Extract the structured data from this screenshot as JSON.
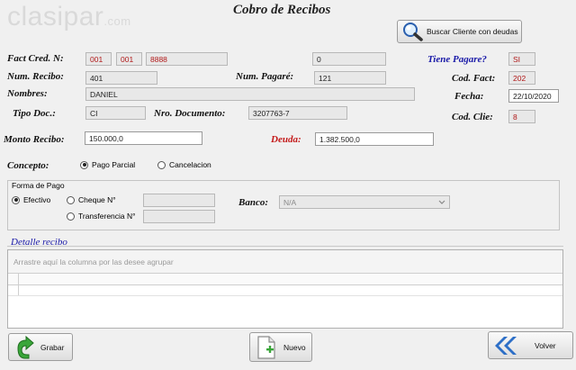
{
  "logo": {
    "text": "clasipar",
    "suffix": ".com"
  },
  "window": {
    "title": "Cobro de Recibos"
  },
  "buttons": {
    "buscar": "Buscar Cliente con deudas",
    "grabar": "Grabar",
    "nuevo": "Nuevo",
    "volver": "Volver"
  },
  "labels": {
    "fact_cred": "Fact Cred. N:",
    "num_recibo": "Num. Recibo:",
    "num_pagare": "Num. Pagaré:",
    "nombres": "Nombres:",
    "tipo_doc": "Tipo Doc.:",
    "nro_documento": "Nro. Documento:",
    "monto_recibo": "Monto Recibo:",
    "deuda": "Deuda:",
    "tiene_pagare": "Tiene Pagare?",
    "cod_fact": "Cod. Fact:",
    "fecha": "Fecha:",
    "cod_clie": "Cod. Clie:",
    "concepto": "Concepto:",
    "forma_pago": "Forma de Pago",
    "banco": "Banco:",
    "detalle": "Detalle recibo"
  },
  "fields": {
    "fact_1": "001",
    "fact_2": "001",
    "fact_3": "8888",
    "extra_value": "0",
    "num_recibo": "401",
    "num_pagare": "121",
    "nombres": "DANIEL",
    "tipo_doc": "CI",
    "nro_documento": "3207763-7",
    "monto_recibo": "150.000,0",
    "deuda": "1.382.500,0",
    "tiene_pagare": "SI",
    "cod_fact": "202",
    "fecha": "22/10/2020",
    "cod_clie": "8",
    "cheque_num": "",
    "transferencia_num": "",
    "banco": "N/A"
  },
  "concepto_options": {
    "pago_parcial": "Pago Parcial",
    "cancelacion": "Cancelacion",
    "selected": "Pago Parcial"
  },
  "forma_pago_options": {
    "efectivo": "Efectivo",
    "cheque": "Cheque N°",
    "transferencia": "Transferencia N°",
    "selected": "Efectivo"
  },
  "grid": {
    "group_hint": "Arrastre aquí la columna por las desee agrupar"
  },
  "colors": {
    "blue_label": "#1a1aa8",
    "red_label": "#c41a1a",
    "red_value": "#b01818"
  }
}
